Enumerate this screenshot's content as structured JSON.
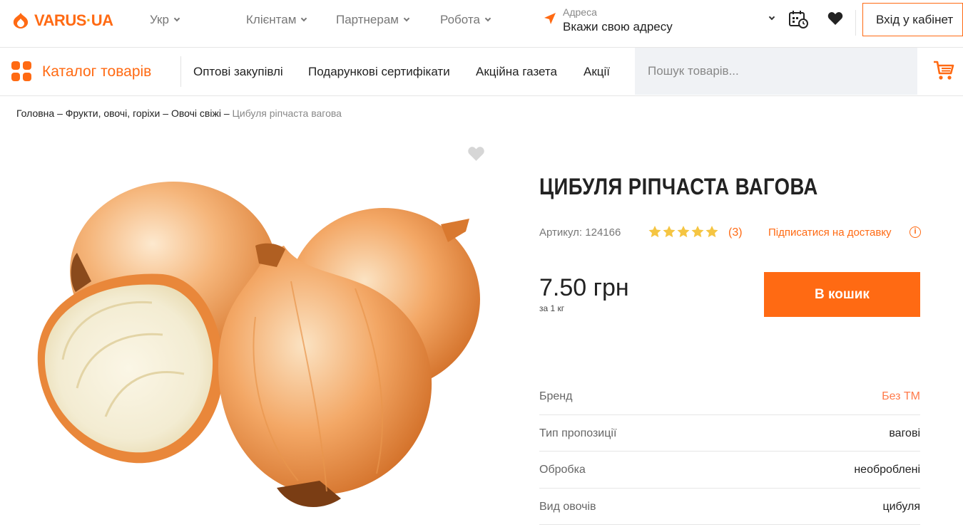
{
  "header": {
    "logo_text": "VARUS",
    "logo_suffix": "UA",
    "lang": "Укр",
    "nav": [
      "Клієнтам",
      "Партнерам",
      "Робота"
    ],
    "address_label": "Адреса",
    "address_value": "Вкажи свою адресу",
    "login_label": "Вхід у кабінет"
  },
  "catbar": {
    "catalog_label": "Каталог товарів",
    "links": [
      "Оптові закупівлі",
      "Подарункові сертифікати",
      "Акційна газета",
      "Акції"
    ],
    "search_placeholder": "Пошук товарів..."
  },
  "breadcrumb": {
    "items": [
      "Головна",
      "Фрукти, овочі, горіхи",
      "Овочі свіжі"
    ],
    "current": "Цибуля ріпчаста вагова",
    "separator": " – "
  },
  "product": {
    "title": "ЦИБУЛЯ РІПЧАСТА ВАГОВА",
    "sku": "Артикул: 124166",
    "rating": 5,
    "reviews": "(3)",
    "subscribe_label": "Підписатися на доставку",
    "price": "7.50 грн",
    "unit": "за 1 кг",
    "buy_label": "В кошик"
  },
  "specs": [
    {
      "key": "Бренд",
      "value": "Без ТМ"
    },
    {
      "key": "Тип пропозиції",
      "value": "вагові"
    },
    {
      "key": "Обробка",
      "value": "необроблені"
    },
    {
      "key": "Вид овочів",
      "value": "цибуля"
    }
  ],
  "colors": {
    "accent": "#ff6a13",
    "star": "#f5c542"
  }
}
